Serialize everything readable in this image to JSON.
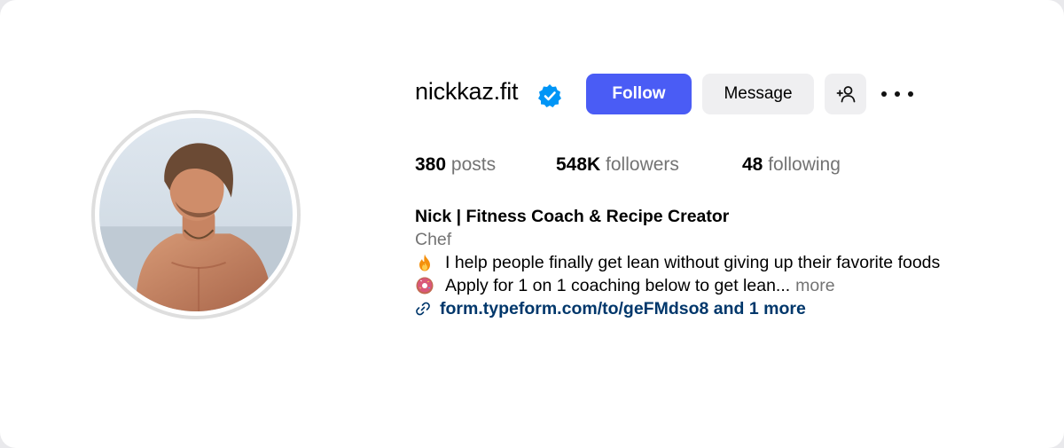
{
  "profile": {
    "username": "nickkaz.fit",
    "verified_icon": "verified-badge-icon",
    "buttons": {
      "follow": "Follow",
      "message": "Message",
      "add_user_icon": "add-user-icon",
      "more_icon": "more-options-icon"
    },
    "stats": {
      "posts_count": "380",
      "posts_label": "posts",
      "followers_count": "548K",
      "followers_label": "followers",
      "following_count": "48",
      "following_label": "following"
    },
    "bio": {
      "name": "Nick | Fitness Coach & Recipe Creator",
      "category": "Chef",
      "line1": "I help people finally get lean without giving up their favorite foods",
      "line1_emoji": "fire-emoji",
      "line2": "Apply for 1 on 1 coaching below to get lean...",
      "line2_emoji": "donut-emoji",
      "more": "more",
      "link": "form.typeform.com/to/geFMdso8 and 1 more",
      "link_icon": "link-icon"
    }
  },
  "colors": {
    "follow_button": "#4a5cf5",
    "secondary_button": "#efeff1",
    "muted_text": "#737373",
    "link_text": "#00376b",
    "verified": "#0095f6"
  }
}
